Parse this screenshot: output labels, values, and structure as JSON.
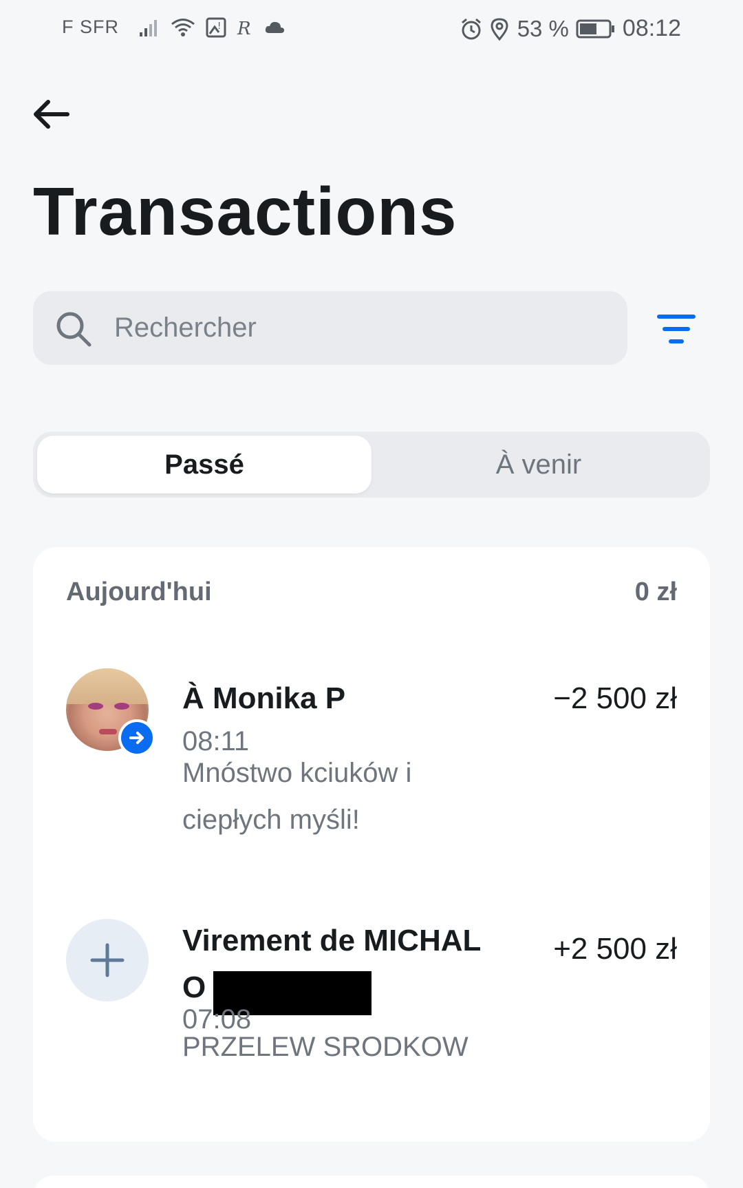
{
  "status_bar": {
    "carrier": "F SFR",
    "battery_percent": "53 %",
    "time": "08:12"
  },
  "header": {
    "title": "Transactions"
  },
  "search": {
    "placeholder": "Rechercher"
  },
  "tabs": [
    {
      "label": "Passé",
      "active": true
    },
    {
      "label": "À venir",
      "active": false
    }
  ],
  "groups": [
    {
      "label": "Aujourd'hui",
      "total": "0 zł",
      "transactions": [
        {
          "title": "À Monika P",
          "amount": "−2 500 zł",
          "time": "08:11",
          "note": "Mnóstwo kciuków i ciepłych myśli!",
          "icon": "outgoing-arrow-icon"
        },
        {
          "title": "Virement de MICHAL O",
          "amount": "+2 500 zł",
          "time": "07:08",
          "note": "PRZELEW SRODKOW",
          "icon": "plus-icon"
        }
      ]
    }
  ],
  "colors": {
    "accent": "#0a6cf0",
    "background": "#f6f7f9",
    "card": "#ffffff",
    "muted_text": "#6f757d"
  }
}
